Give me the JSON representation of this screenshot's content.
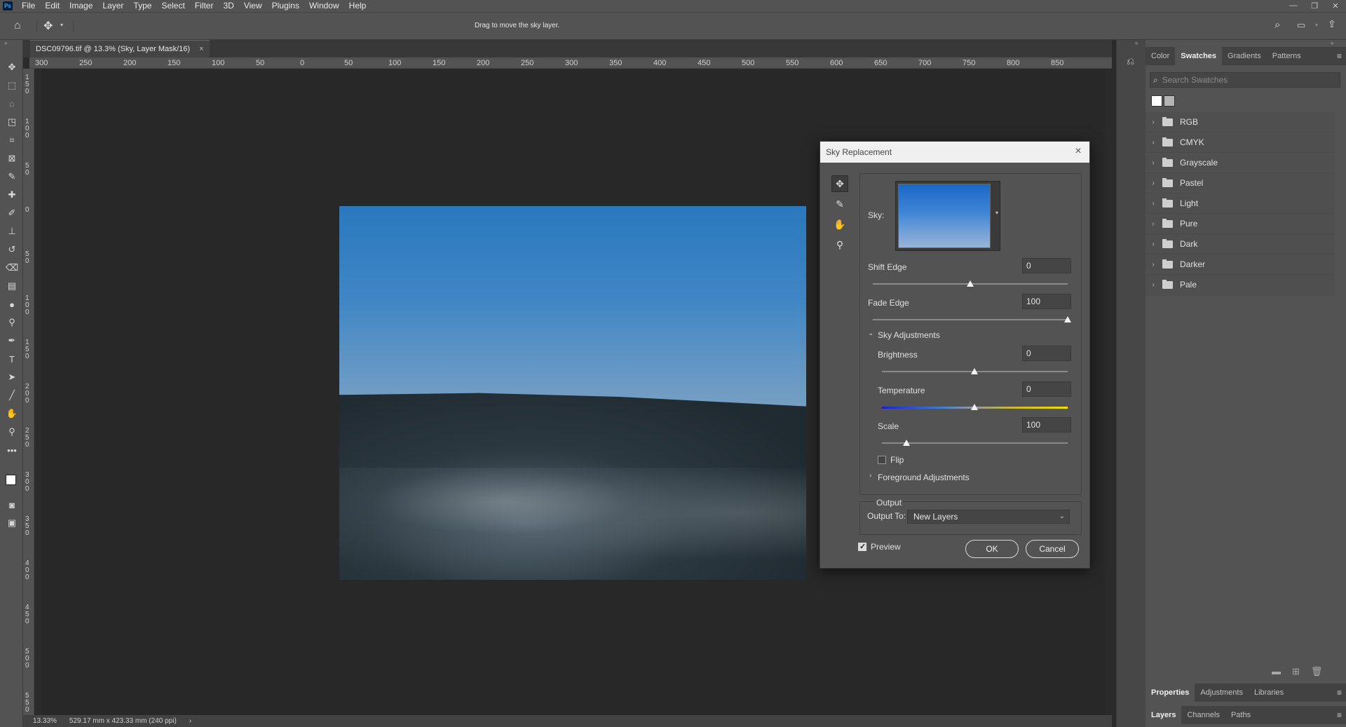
{
  "menu": [
    "File",
    "Edit",
    "Image",
    "Layer",
    "Type",
    "Select",
    "Filter",
    "3D",
    "View",
    "Plugins",
    "Window",
    "Help"
  ],
  "app_logo": "Ps",
  "options_hint": "Drag to move the sky layer.",
  "document_tab": {
    "title": "DSC09796.tif @ 13.3% (Sky, Layer Mask/16)",
    "close": "×"
  },
  "h_ruler": [
    "300",
    "250",
    "200",
    "150",
    "100",
    "50",
    "0",
    "50",
    "100",
    "150",
    "200",
    "250",
    "300",
    "350",
    "400",
    "450",
    "500",
    "550",
    "600",
    "650",
    "700",
    "750",
    "800",
    "850"
  ],
  "v_ruler": [
    "150",
    "100",
    "50",
    "0",
    "50",
    "100",
    "150",
    "200",
    "250",
    "300",
    "350",
    "400",
    "450",
    "500",
    "550"
  ],
  "status": {
    "zoom": "13.33%",
    "size": "529.17 mm x 423.33 mm (240 ppi)",
    "arrow": "›"
  },
  "swatches_panel": {
    "tabs": [
      "Color",
      "Swatches",
      "Gradients",
      "Patterns"
    ],
    "active_tab": "Swatches",
    "search_placeholder": "Search Swatches",
    "recent_colors": [
      "#ffffff",
      "#b4b4b4"
    ],
    "groups": [
      "RGB",
      "CMYK",
      "Grayscale",
      "Pastel",
      "Light",
      "Pure",
      "Dark",
      "Darker",
      "Pale"
    ]
  },
  "properties_tabs": [
    "Properties",
    "Adjustments",
    "Libraries"
  ],
  "layers_tabs": [
    "Layers",
    "Channels",
    "Paths"
  ],
  "dialog": {
    "title": "Sky Replacement",
    "sky_label": "Sky:",
    "shift_edge": {
      "label": "Shift Edge",
      "value": "0"
    },
    "fade_edge": {
      "label": "Fade Edge",
      "value": "100"
    },
    "sky_adjustments_label": "Sky Adjustments",
    "brightness": {
      "label": "Brightness",
      "value": "0"
    },
    "temperature": {
      "label": "Temperature",
      "value": "0"
    },
    "scale": {
      "label": "Scale",
      "value": "100"
    },
    "flip_label": "Flip",
    "foreground_adjustments_label": "Foreground Adjustments",
    "output_section_label": "Output",
    "output_to_label": "Output To:",
    "output_to_value": "New Layers",
    "preview_label": "Preview",
    "ok_label": "OK",
    "cancel_label": "Cancel"
  },
  "colors": {
    "accent_blue": "#2a78be",
    "panel_bg": "#535353",
    "canvas_bg": "#282828"
  }
}
